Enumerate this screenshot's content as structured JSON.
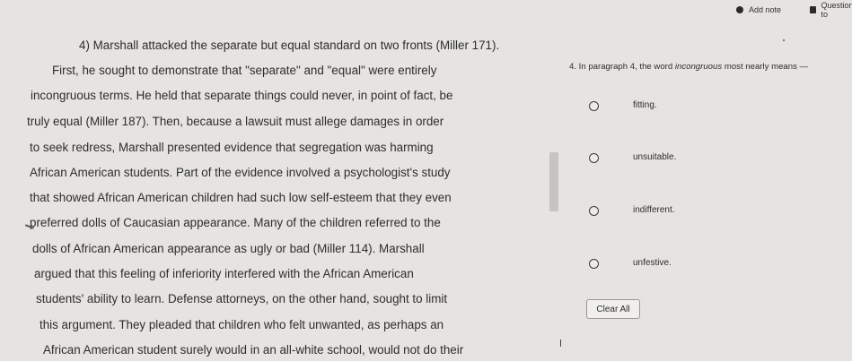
{
  "toolbar": {
    "add_note_label": "Add note",
    "question_tools_label": "Question to"
  },
  "passage": {
    "lines": [
      "4) Marshall attacked the separate but equal standard on two fronts (Miller 171).",
      "First, he sought to demonstrate that \"separate\" and \"equal\" were entirely",
      "incongruous terms. He held that separate things could never, in point of fact, be",
      "truly equal (Miller 187). Then, because a lawsuit must allege damages in order",
      "to seek redress, Marshall presented evidence that segregation was harming",
      "African American students. Part of the evidence involved a psychologist's study",
      "that showed African American children had such low self-esteem that they even",
      "preferred dolls of Caucasian appearance. Many of the children referred to the",
      "dolls of African American appearance as ugly or bad (Miller 114). Marshall",
      "argued that this feeling of inferiority interfered with the African American",
      "students' ability to learn. Defense attorneys, on the other hand, sought to limit",
      "this argument. They pleaded that children who felt unwanted, as perhaps an",
      "African American student surely would in an all-white school, would not do their"
    ]
  },
  "question": {
    "prompt_before": "4.  In paragraph 4, the word ",
    "prompt_term": "incongruous",
    "prompt_after": " most nearly means —",
    "choices": [
      {
        "label": "fitting."
      },
      {
        "label": "unsuitable."
      },
      {
        "label": "indifferent."
      },
      {
        "label": "unfestive."
      }
    ],
    "clear_all_label": "Clear All"
  }
}
